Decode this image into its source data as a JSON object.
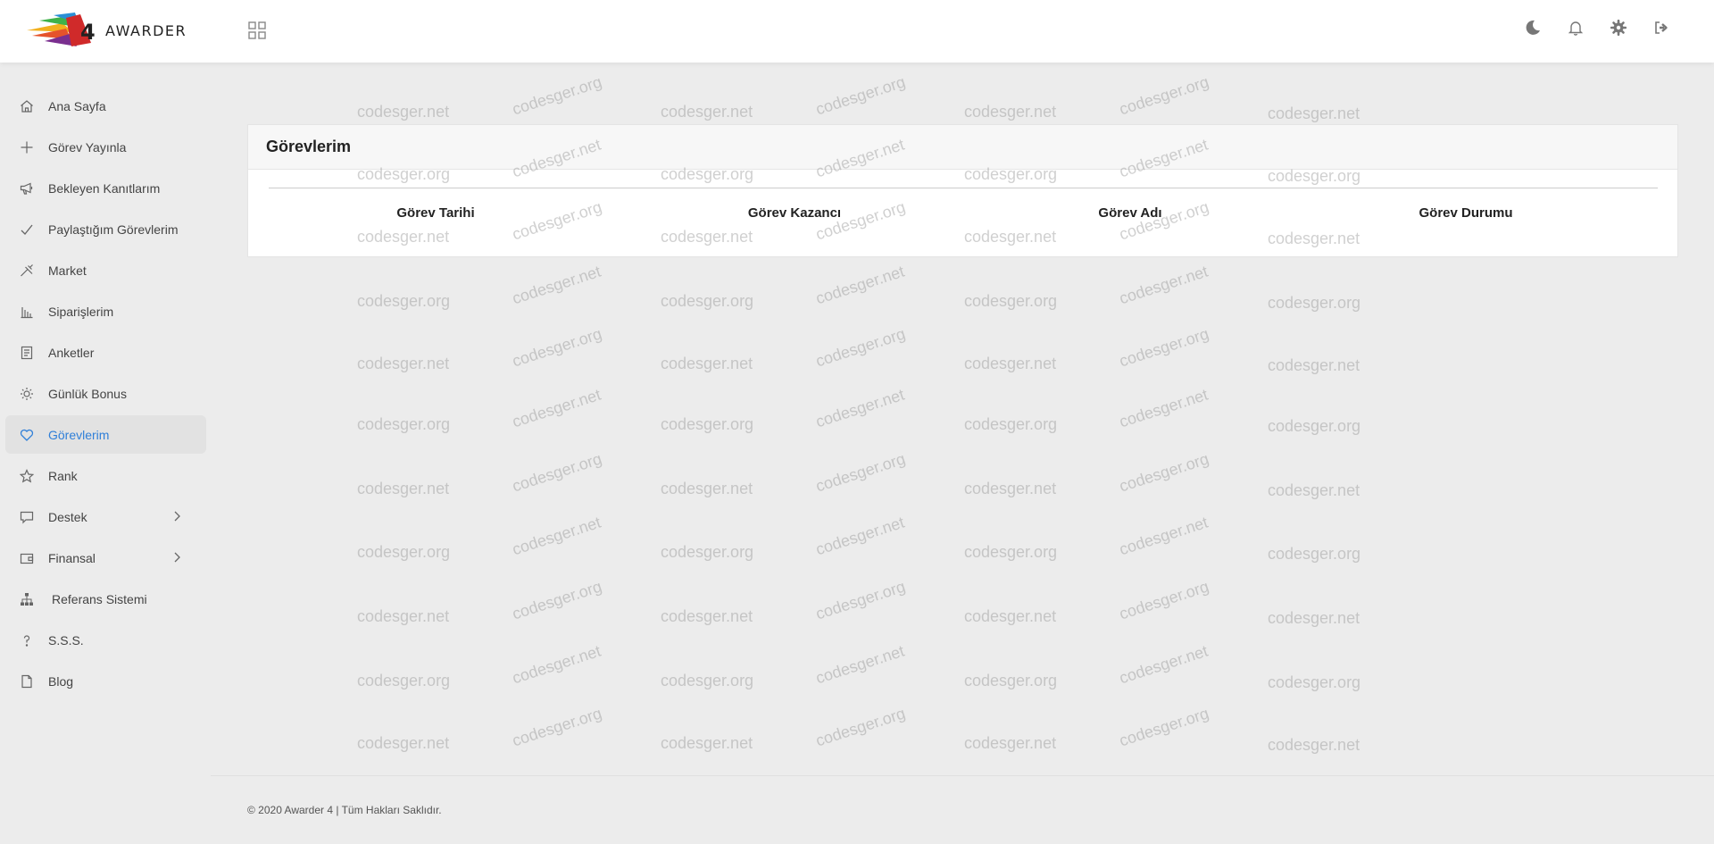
{
  "header": {
    "logo_text": "AWARDER",
    "logo_badge": "4",
    "icons": [
      "grid-icon",
      "moon-icon",
      "bell-icon",
      "gear-icon",
      "logout-icon"
    ]
  },
  "sidebar": {
    "items": [
      {
        "label": "Ana Sayfa",
        "icon": "home-icon"
      },
      {
        "label": "Görev Yayınla",
        "icon": "plus-icon"
      },
      {
        "label": "Bekleyen Kanıtlarım",
        "icon": "megaphone-icon"
      },
      {
        "label": "Paylaştığım Görevlerim",
        "icon": "check-icon"
      },
      {
        "label": "Market",
        "icon": "market-icon"
      },
      {
        "label": "Siparişlerim",
        "icon": "bar-chart-icon"
      },
      {
        "label": "Anketler",
        "icon": "document-icon"
      },
      {
        "label": "Günlük Bonus",
        "icon": "sun-icon"
      },
      {
        "label": "Görevlerim",
        "icon": "heart-icon",
        "active": true
      },
      {
        "label": "Rank",
        "icon": "star-icon"
      },
      {
        "label": "Destek",
        "icon": "chat-icon",
        "has_submenu": true
      },
      {
        "label": "Finansal",
        "icon": "wallet-icon",
        "has_submenu": true
      },
      {
        "label": "Referans Sistemi",
        "icon": "sitemap-icon"
      },
      {
        "label": "S.S.S.",
        "icon": "question-icon"
      },
      {
        "label": "Blog",
        "icon": "file-icon"
      }
    ]
  },
  "card": {
    "title": "Görevlerim",
    "columns": [
      "Görev Tarihi",
      "Görev Kazancı",
      "Görev Adı",
      "Görev Durumu"
    ]
  },
  "watermark": {
    "text_a": "codesger.net",
    "text_b": "codesger.org"
  },
  "footer": {
    "text": "© 2020 Awarder 4 | Tüm Hakları Saklıdır."
  },
  "colors": {
    "accent": "#2f7fd8",
    "background": "#ececec",
    "header_bg": "#ffffff"
  }
}
